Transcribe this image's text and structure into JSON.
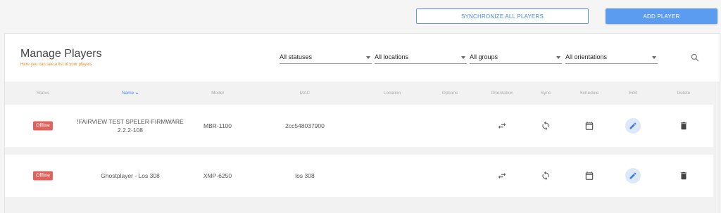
{
  "actions": {
    "sync_label": "Synchronize all players",
    "add_label": "ADD PLAYER"
  },
  "header": {
    "title": "Manage Players",
    "subtitle": "Here you can see a list of your players"
  },
  "filters": {
    "status": "All statuses",
    "location": "All locations",
    "group": "All groups",
    "orientation": "All orientations"
  },
  "columns": {
    "status": "Status",
    "name": "Name",
    "model": "Model",
    "mac": "MAC",
    "location": "Location",
    "options": "Options",
    "orientation": "Orientation",
    "sync": "Sync",
    "schedule": "Schedule",
    "edit": "Edit",
    "delete": "Delete"
  },
  "sort_indicator": "▲",
  "players": [
    {
      "status": "Offline",
      "name": "!FAIRVIEW TEST SPELER-FIRMWARE 2.2.2-108",
      "model": "MBR-1100",
      "mac": "2cc548037900"
    },
    {
      "status": "Offline",
      "name": "Ghostplayer - Los 308",
      "model": "XMP-6250",
      "mac": "los 308"
    }
  ],
  "colors": {
    "accent": "#5b9cf0",
    "offline_badge": "#e0625a",
    "subtitle": "#e8902a"
  }
}
